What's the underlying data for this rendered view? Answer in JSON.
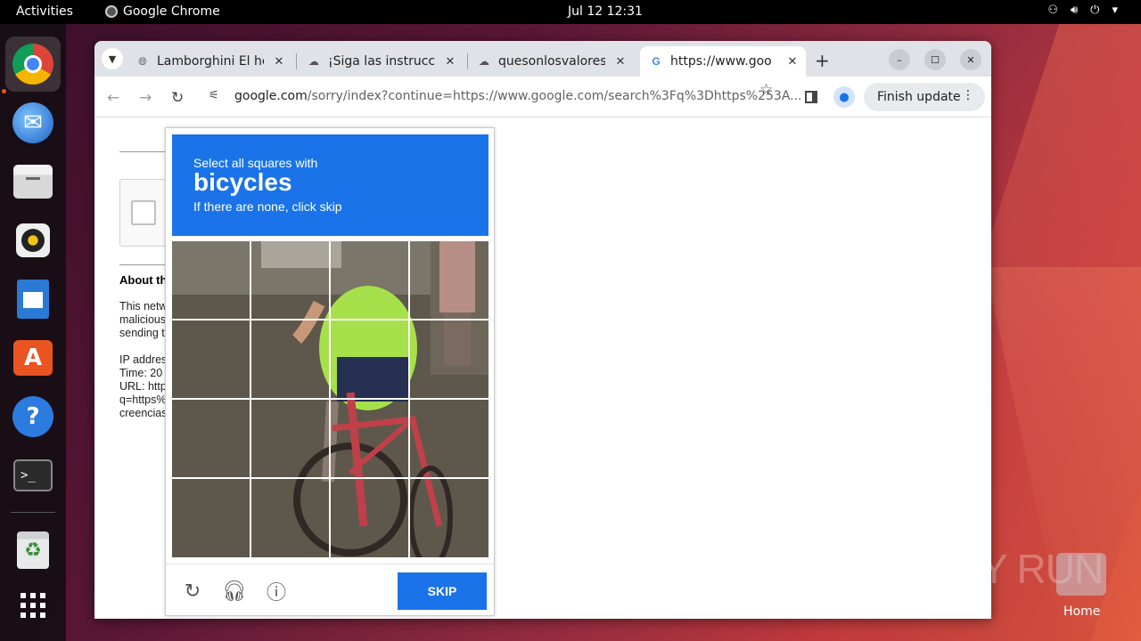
{
  "topbar": {
    "activities": "Activities",
    "app_name": "Google Chrome",
    "clock": "Jul 12  12:31"
  },
  "dock": {
    "items": [
      "chrome-icon",
      "thunderbird-icon",
      "files-icon",
      "rhythmbox-icon",
      "writer-icon",
      "app-center-icon",
      "help-icon",
      "terminal-icon",
      "trash-icon",
      "show-apps-icon"
    ]
  },
  "browser": {
    "tabs": [
      {
        "title": "Lamborghini El he",
        "favicon": "globe-icon",
        "active": false
      },
      {
        "title": "¡Siga las instrucci",
        "favicon": "download-icon",
        "active": false
      },
      {
        "title": "quesonlosvalores",
        "favicon": "download-icon",
        "active": false
      },
      {
        "title": "https://www.goo",
        "favicon": "google-icon",
        "active": true
      }
    ],
    "url_host": "google.com",
    "url_rest": "/sorry/index?continue=https://www.google.com/search%3Fq%3Dhttps%253A...",
    "finish_update": "Finish update"
  },
  "page": {
    "about": "About th",
    "para1": [
      "This netw",
      "malicious",
      "sending t"
    ],
    "para2": [
      "IP addres",
      "Time: 20",
      "URL: http",
      "q=https%",
      "creencias"
    ]
  },
  "captcha": {
    "line1": "Select all squares with",
    "target": "bicycles",
    "line3": "If there are none, click skip",
    "skip_label": "SKIP",
    "grid_rows": 4,
    "grid_cols": 4
  },
  "desktop": {
    "watermark": "ANY RUN",
    "home_label": "Home"
  },
  "colors": {
    "captcha_blue": "#1a73e8",
    "ubuntu_orange": "#e95420"
  }
}
